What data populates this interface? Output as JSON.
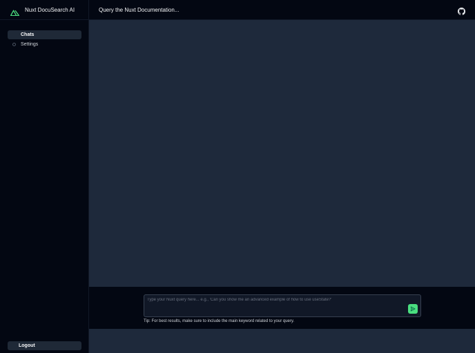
{
  "app": {
    "name": "Nuxt DocuSearch AI",
    "logo_icon": "nuxt-logo-icon",
    "accent_color": "#4ade80"
  },
  "sidebar": {
    "items": [
      {
        "label": "Chats",
        "active": true,
        "icon": ""
      },
      {
        "label": "Settings",
        "active": false,
        "icon": "circle-icon"
      }
    ],
    "logout_label": "Logout"
  },
  "header": {
    "title": "Query the Nuxt Documentation...",
    "github_icon": "github-icon"
  },
  "composer": {
    "placeholder": "Type your Nuxt query here... e.g., 'Can you show me an advanced example of how to use useState?'",
    "value": "",
    "send_icon": "send-icon",
    "tip": "Tip: For best results, make sure to include the main keyword related to your query."
  }
}
